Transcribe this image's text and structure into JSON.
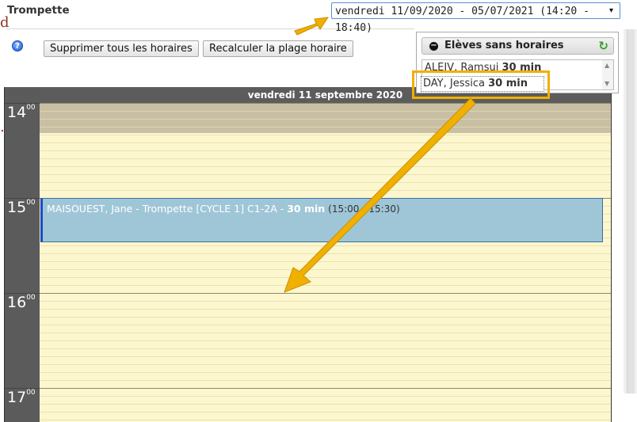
{
  "header": {
    "title": "Trompette",
    "period_select_value": "vendredi 11/09/2020 - 05/07/2021 (14:20 - 18:40)"
  },
  "toolbar": {
    "help_glyph": "?",
    "delete_all_label": "Supprimer tous les horaires",
    "recalc_label": "Recalculer la plage horaire"
  },
  "calendar": {
    "day_header": "vendredi 11 septembre 2020",
    "hours": [
      {
        "h": "14",
        "m": "00"
      },
      {
        "h": "15",
        "m": "00"
      },
      {
        "h": "16",
        "m": "00"
      },
      {
        "h": "17",
        "m": "00"
      }
    ],
    "event": {
      "text": "MAISOUEST, Jane - Trompette [CYCLE 1] C1-2A - ",
      "duration": "30 min",
      "range": "(15:00 - 15:30)"
    }
  },
  "students_panel": {
    "title": "Elèves sans horaires",
    "items": [
      {
        "name": "ALEIV, Ramsui",
        "duration": "30 min"
      },
      {
        "name": "DAY, Jessica",
        "duration": "30 min"
      }
    ]
  },
  "colors": {
    "highlight": "#f0b000",
    "event_bg": "#9fc6d7",
    "grid_bg": "#fcf7ce",
    "gutter_bg": "#5b5b5b"
  }
}
